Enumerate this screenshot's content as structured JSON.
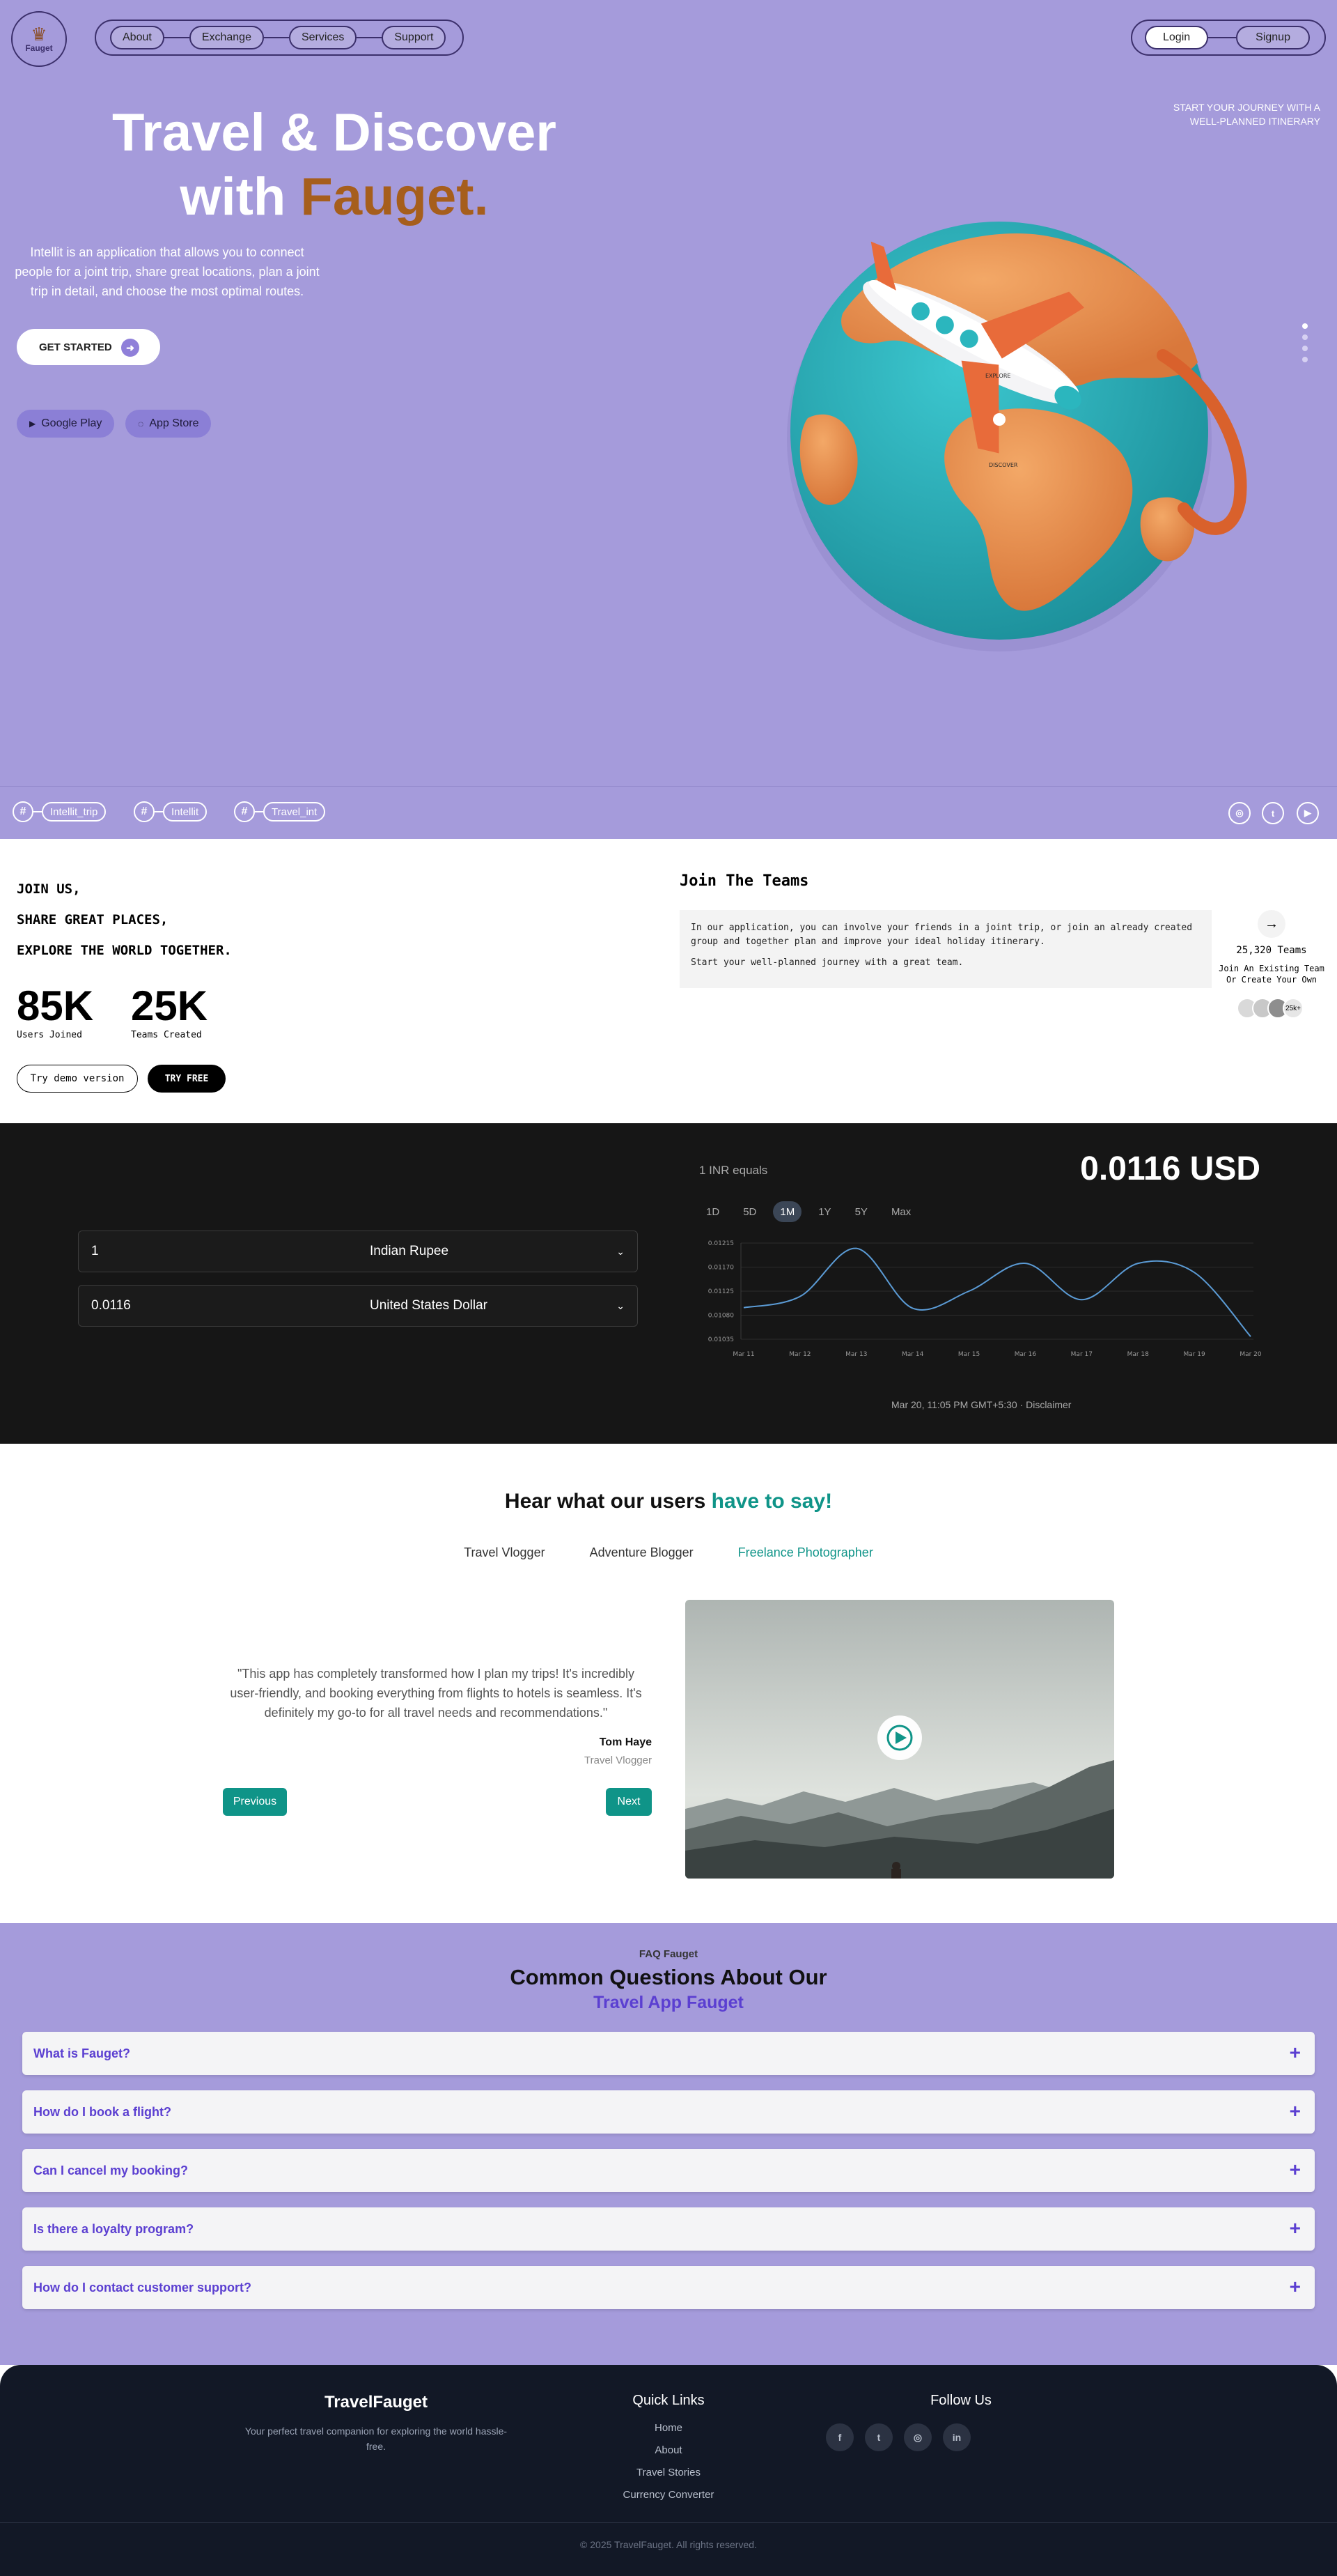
{
  "header": {
    "logo_text": "Fauget",
    "nav": [
      "About",
      "Exchange",
      "Services",
      "Support"
    ],
    "login_label": "Login",
    "signup_label": "Signup"
  },
  "hero": {
    "title_line1": "Travel & Discover",
    "title_with": "with ",
    "title_brand": "Fauget.",
    "description": "Intellit is an application that allows you to connect people for a joint trip, share great locations, plan a joint trip in detail, and choose the most optimal routes.",
    "cta_label": "GET STARTED",
    "google_play": "Google Play",
    "app_store": "App Store",
    "tagline": "START YOUR JOURNEY WITH A WELL-PLANNED ITINERARY",
    "globe_labels": [
      "EXPLORE",
      "DISCOVER"
    ],
    "slide_count": 4,
    "active_slide": 0
  },
  "tags": {
    "hashtags": [
      "Intellit_trip",
      "Intellit",
      "Travel_int"
    ],
    "social": [
      "instagram-icon",
      "twitter-icon",
      "youtube-icon"
    ]
  },
  "join": {
    "lines": [
      "JOIN US,",
      "SHARE GREAT PLACES,",
      "EXPLORE THE WORLD TOGETHER."
    ],
    "stats": [
      {
        "num": "85K",
        "label": "Users Joined"
      },
      {
        "num": "25K",
        "label": "Teams Created"
      }
    ],
    "demo_label": "Try demo version",
    "free_label": "TRY FREE",
    "teams_title": "Join The Teams",
    "teams_p1": "In our application, you can involve your friends in a joint trip, or join an already created group and together plan and improve your ideal holiday itinerary.",
    "teams_p2": "Start your well-planned journey with a great team.",
    "teams_count": "25,320 Teams",
    "teams_sub": "Join An Existing Team Or Create Your Own",
    "avatar_more": "25k+"
  },
  "exchange": {
    "from_value": "1",
    "from_currency": "Indian Rupee",
    "to_value": "0.0116",
    "to_currency": "United States Dollar",
    "equals_label": "1 INR equals",
    "result": "0.0116 USD",
    "ranges": [
      "1D",
      "5D",
      "1M",
      "1Y",
      "5Y",
      "Max"
    ],
    "active_range": "1M",
    "timestamp": "Mar 20, 11:05 PM GMT+5:30 · Disclaimer",
    "colors": {
      "line": "#5b9bd5",
      "bg": "#161616"
    }
  },
  "chart_data": {
    "type": "line",
    "x": [
      "Mar 11",
      "Mar 12",
      "Mar 13",
      "Mar 14",
      "Mar 15",
      "Mar 16",
      "Mar 17",
      "Mar 18",
      "Mar 19",
      "Mar 20"
    ],
    "yticks": [
      "0.01215",
      "0.01170",
      "0.01125",
      "0.01080",
      "0.01035"
    ],
    "series": [
      {
        "values": [
          0.01094,
          0.01115,
          0.01205,
          0.01093,
          0.01125,
          0.01177,
          0.01109,
          0.01177,
          0.0116,
          0.0104
        ]
      }
    ],
    "ylim": [
      0.01035,
      0.01215
    ],
    "grid": true
  },
  "testimonials": {
    "title_main": "Hear what our users ",
    "title_accent": "have to say!",
    "tabs": [
      "Travel Vlogger",
      "Adventure Blogger",
      "Freelance Photographer"
    ],
    "active_tab": "Freelance Photographer",
    "quote": "\"This app has completely transformed how I plan my trips! It's incredibly user-friendly, and booking everything from flights to hotels is seamless. It's definitely my go-to for all travel needs and recommendations.\"",
    "name": "Tom Haye",
    "role": "Travel Vlogger",
    "prev_label": "Previous",
    "next_label": "Next"
  },
  "faq": {
    "kicker": "FAQ Fauget",
    "title": "Common Questions About Our",
    "subtitle": "Travel App Fauget",
    "items": [
      "What is Fauget?",
      "How do I book a flight?",
      "Can I cancel my booking?",
      "Is there a loyalty program?",
      "How do I contact customer support?"
    ]
  },
  "footer": {
    "brand": "TravelFauget",
    "tagline": "Your perfect travel companion for exploring the world hassle-free.",
    "quick_links_title": "Quick Links",
    "links": [
      "Home",
      "About",
      "Travel Stories",
      "Currency Converter"
    ],
    "follow_title": "Follow Us",
    "social": [
      "facebook-icon",
      "twitter-icon",
      "instagram-icon",
      "linkedin-icon"
    ],
    "copyright": "© 2025 TravelFauget. All rights reserved."
  }
}
